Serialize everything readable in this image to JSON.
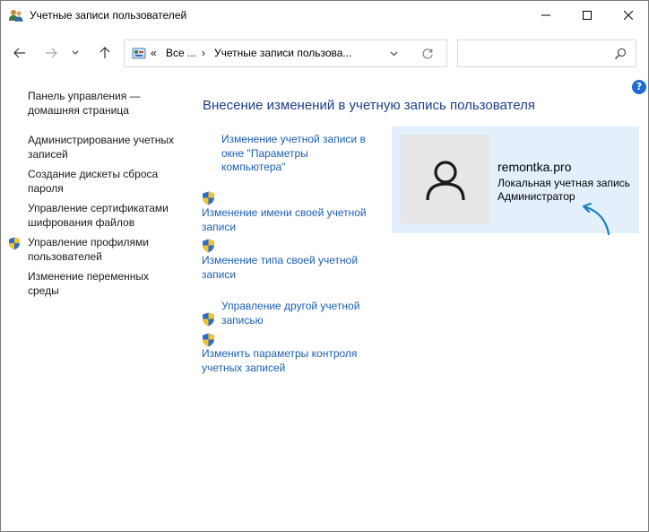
{
  "window": {
    "title": "Учетные записи пользователей"
  },
  "address": {
    "chevron": "«",
    "segment1": "Все ...",
    "separator": "›",
    "segment2": "Учетные записи пользова...",
    "search_placeholder": ""
  },
  "help": {
    "label": "?"
  },
  "sidebar": {
    "items": [
      {
        "label": "Панель управления — домашняя страница"
      },
      {
        "label": "Администрирование учетных записей"
      },
      {
        "label": "Создание дискеты сброса пароля"
      },
      {
        "label": "Управление сертификатами шифрования файлов"
      },
      {
        "label": "Управление профилями пользователей",
        "icon": "uac-shield-icon"
      },
      {
        "label": "Изменение переменных среды"
      }
    ]
  },
  "main": {
    "heading": "Внесение изменений в учетную запись пользователя",
    "links": [
      {
        "label": "Изменение учетной записи в окне \"Параметры компьютера\""
      },
      {
        "label": "Изменение имени своей учетной записи",
        "icon": "uac-shield-icon"
      },
      {
        "label": "Изменение типа своей учетной записи",
        "icon": "uac-shield-icon"
      },
      {
        "label": "Управление другой учетной записью",
        "icon": "uac-shield-icon"
      },
      {
        "label": "Изменить параметры контроля учетных записей",
        "icon": "uac-shield-icon"
      }
    ]
  },
  "user": {
    "name": "remontka.pro",
    "type": "Локальная учетная запись",
    "role": "Администратор"
  },
  "colors": {
    "link": "#1a5fb4",
    "heading": "#1e3f8c",
    "card_bg": "#e3f0fc",
    "annotation": "#1b7fc2"
  }
}
